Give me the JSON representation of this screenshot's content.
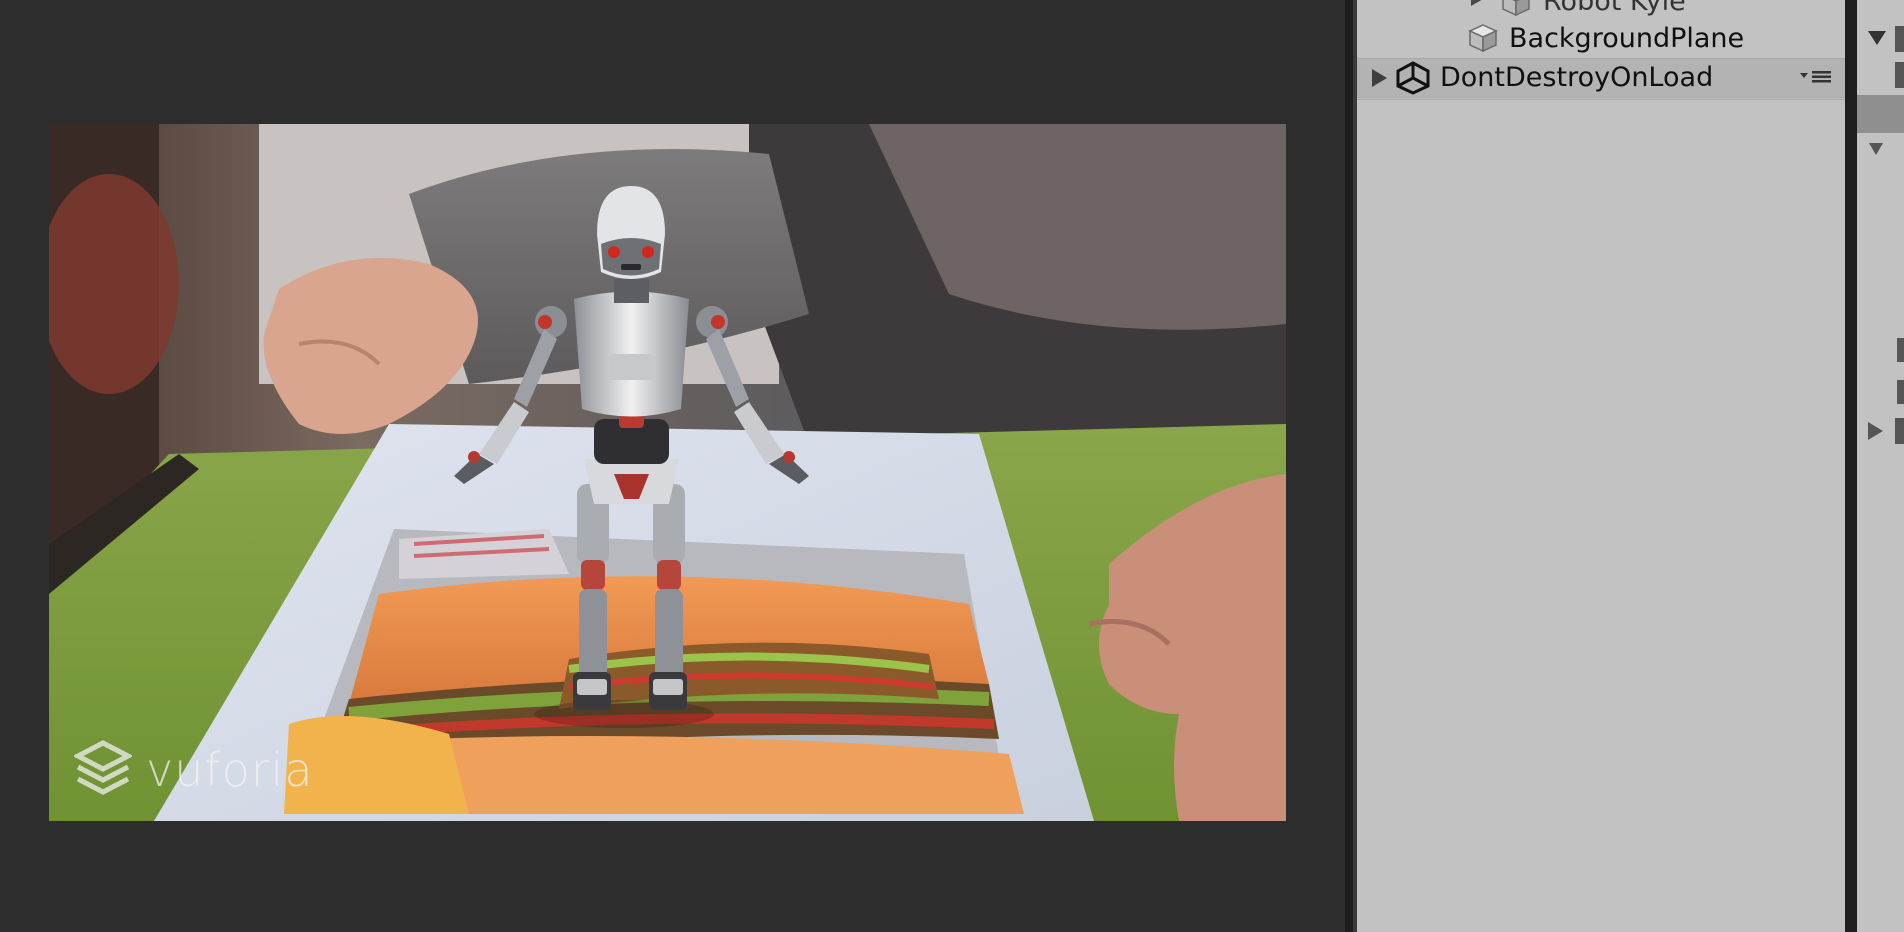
{
  "game_view": {
    "watermark": "vuforia",
    "watermark_icon": "vuforia-cube-icon"
  },
  "hierarchy": {
    "items": [
      {
        "label": "Robot Kyle",
        "icon": "cube-icon",
        "expandable": true
      },
      {
        "label": "BackgroundPlane",
        "icon": "cube-icon",
        "expandable": false
      },
      {
        "label": "DontDestroyOnLoad",
        "icon": "unity-scene-icon",
        "expandable": true,
        "has_menu": true
      }
    ]
  },
  "colors": {
    "editor_dark": "#2d2d2d",
    "panel_gray": "#c2c2c2",
    "row_highlight": "#b3b3b3",
    "selection": "#8f8f8f"
  }
}
